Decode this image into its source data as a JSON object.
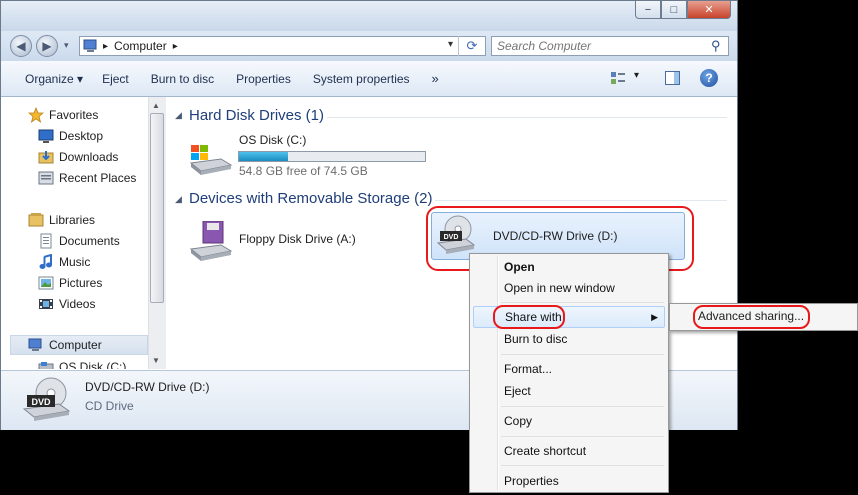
{
  "window": {
    "caption_min": "−",
    "caption_max": "□",
    "caption_close": "✕"
  },
  "address": {
    "back_icon": "◀",
    "forward_icon": "▶",
    "breadcrumb_arrow": "▸",
    "location": "Computer",
    "trail_arrow": "▸",
    "dropdown": "▾",
    "refresh": "⟳",
    "search_placeholder": "Search Computer",
    "search_icon": "⚲"
  },
  "toolbar": {
    "organize": "Organize ▾",
    "eject": "Eject",
    "burn": "Burn to disc",
    "properties": "Properties",
    "system_properties": "System properties",
    "more": "»",
    "view_dropdown": "▾",
    "help": "?"
  },
  "nav": {
    "favorites": "Favorites",
    "desktop": "Desktop",
    "downloads": "Downloads",
    "recent": "Recent Places",
    "libraries": "Libraries",
    "documents": "Documents",
    "music": "Music",
    "pictures": "Pictures",
    "videos": "Videos",
    "computer": "Computer",
    "osdisk": "OS Disk (C:)"
  },
  "content": {
    "hdd_group": "Hard Disk Drives (1)",
    "os_disk_name": "OS Disk (C:)",
    "os_disk_free": "54.8 GB free of 74.5 GB",
    "os_disk_used_fraction": 0.264,
    "removable_group": "Devices with Removable Storage (2)",
    "floppy_name": "Floppy Disk Drive (A:)",
    "dvd_name": "DVD/CD-RW Drive (D:)",
    "dvd_badge": "DVD"
  },
  "details": {
    "name": "DVD/CD-RW Drive (D:)",
    "type": "CD Drive",
    "badge": "DVD"
  },
  "context_menu": {
    "open": "Open",
    "open_new_window": "Open in new window",
    "share_with": "Share with",
    "submenu_arrow": "▶",
    "burn_to_disc": "Burn to disc",
    "format": "Format...",
    "eject": "Eject",
    "copy": "Copy",
    "create_shortcut": "Create shortcut",
    "properties": "Properties"
  },
  "submenu": {
    "advanced_sharing": "Advanced sharing..."
  },
  "colors": {
    "highlight_ring": "#e8191a",
    "usage_bar": "#2a9fd0"
  }
}
